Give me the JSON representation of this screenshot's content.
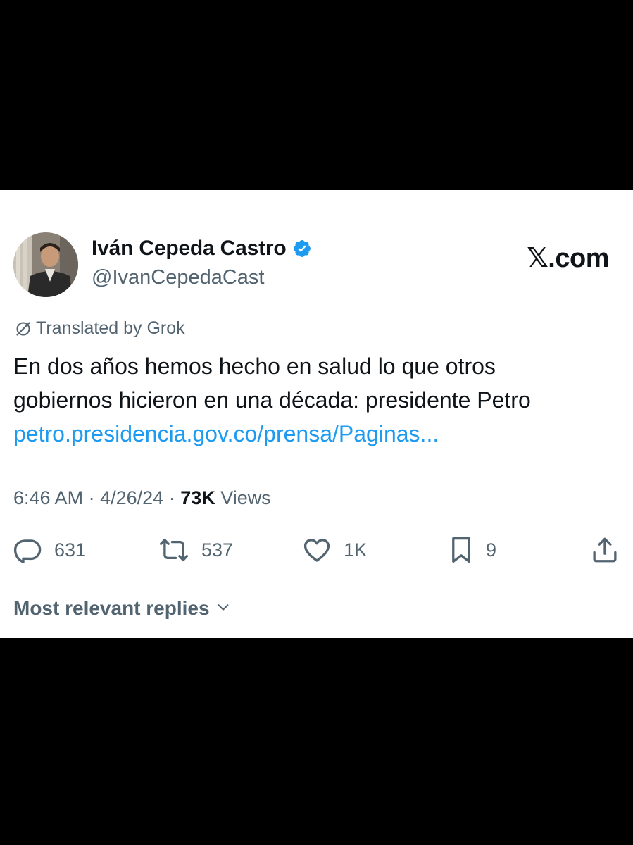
{
  "tweet": {
    "author": {
      "display_name": "Iván Cepeda Castro",
      "handle": "@IvanCepedaCast",
      "verified": true
    },
    "brand": "𝕏.com",
    "translation_note": "Translated by Grok",
    "text_lines": [
      "En dos años hemos hecho en salud lo que otros",
      "gobiernos hicieron en una década: presidente Petro"
    ],
    "link": "petro.presidencia.gov.co/prensa/Paginas...",
    "time": "6:46 AM",
    "separator": "·",
    "date": "4/26/24",
    "views_count": "73K",
    "views_label": "Views"
  },
  "actions": {
    "replies": "631",
    "reposts": "537",
    "likes": "1K",
    "bookmarks": "9"
  },
  "replies_sort": {
    "label": "Most relevant replies"
  },
  "colors": {
    "text": "#0f1419",
    "secondary": "#536471",
    "link": "#1d9bf0",
    "verified": "#1d9bf0",
    "background": "#ffffff",
    "frame": "#000000"
  },
  "icons": [
    "verified-badge-icon",
    "translate-icon",
    "reply-icon",
    "repost-icon",
    "like-icon",
    "bookmark-icon",
    "share-icon",
    "chevron-down-icon"
  ]
}
